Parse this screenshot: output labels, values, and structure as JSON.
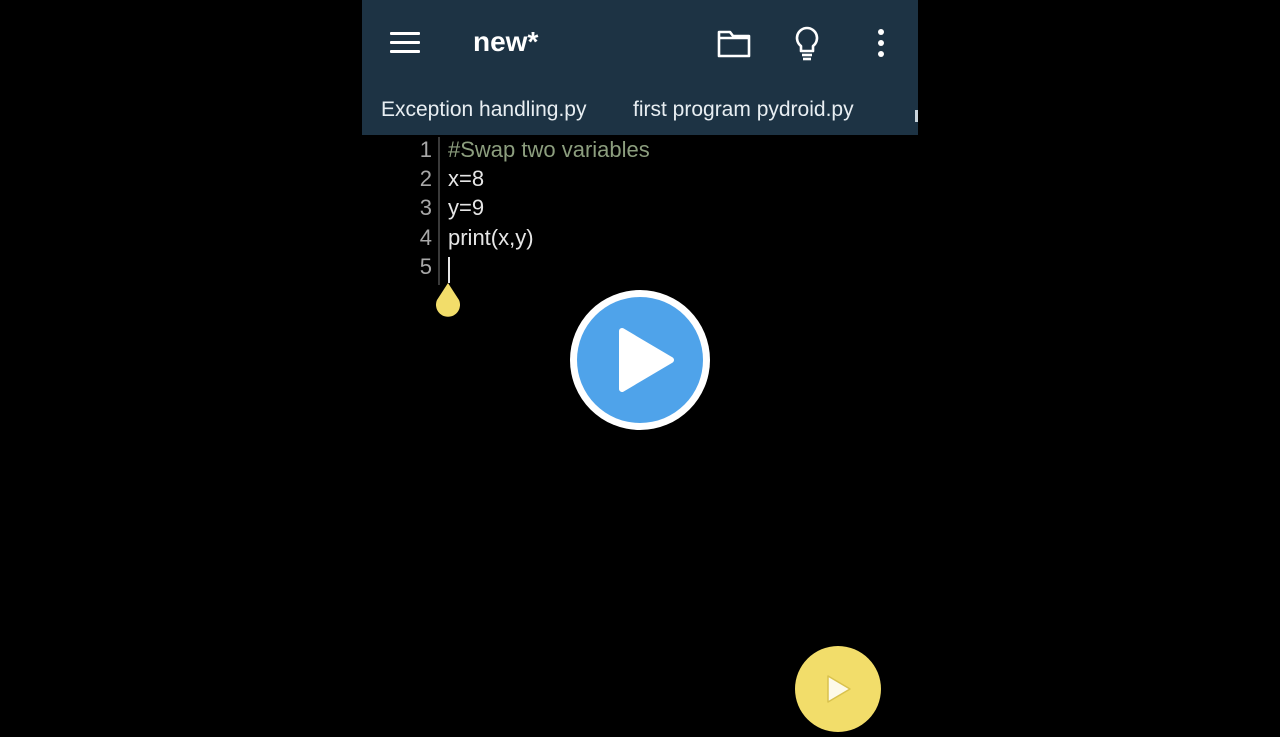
{
  "app": {
    "title": "new*"
  },
  "toolbar": {
    "icons": [
      "menu-icon",
      "folder-icon",
      "lightbulb-icon",
      "more-vert-icon"
    ]
  },
  "tabs": [
    {
      "label": "Exception handling.py"
    },
    {
      "label": "first program pydroid.py"
    }
  ],
  "editor": {
    "lines": [
      {
        "number": "1",
        "text": "#Swap two variables",
        "kind": "comment"
      },
      {
        "number": "2",
        "text": "x=8",
        "kind": "code"
      },
      {
        "number": "3",
        "text": "y=9",
        "kind": "code"
      },
      {
        "number": "4",
        "text": "print(x,y)",
        "kind": "code"
      },
      {
        "number": "5",
        "text": "",
        "kind": "code"
      }
    ]
  },
  "colors": {
    "appbar": "#1d3344",
    "accent_yellow": "#f2dd6a",
    "play_blue": "#4fa3ea",
    "comment": "#8c9e7e"
  },
  "overlay": {
    "play_icon": "play-icon",
    "run_icon": "run-icon"
  }
}
